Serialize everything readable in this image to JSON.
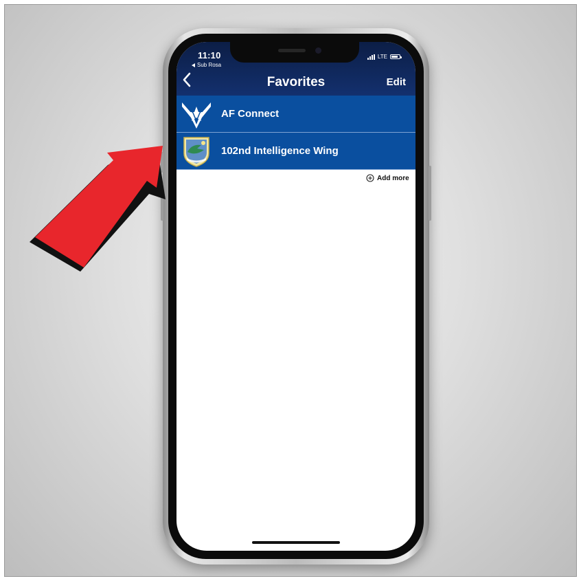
{
  "status_bar": {
    "time": "11:10",
    "back_app": "Sub Rosa",
    "network": "LTE"
  },
  "nav": {
    "title": "Favorites",
    "edit_label": "Edit",
    "back_icon": "chevron-left-icon"
  },
  "favorites": [
    {
      "label": "AF Connect",
      "icon": "air-force-emblem-icon"
    },
    {
      "label": "102nd Intelligence Wing",
      "icon": "wing-shield-emblem-icon"
    }
  ],
  "add_more": {
    "label": "Add more",
    "icon": "plus-circle-icon"
  },
  "colors": {
    "header": "#13306e",
    "row": "#0a4f9f",
    "arrow": "#e8262c"
  }
}
